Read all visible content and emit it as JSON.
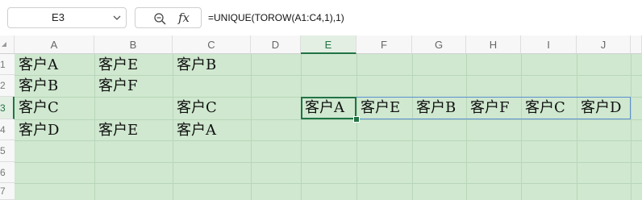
{
  "formula_bar": {
    "name_box": "E3",
    "fx_label": "fx",
    "formula": "=UNIQUE(TOROW(A1:C4,1),1)"
  },
  "columns": [
    "A",
    "B",
    "C",
    "D",
    "E",
    "F",
    "G",
    "H",
    "I",
    "J"
  ],
  "rows": [
    "1",
    "2",
    "3",
    "4",
    "5",
    "6",
    "7"
  ],
  "cells": {
    "A1": "客户A",
    "B1": "客户E",
    "C1": "客户B",
    "A2": "客户B",
    "B2": "客户F",
    "A3": "客户C",
    "C3": "客户C",
    "A4": "客户D",
    "B4": "客户E",
    "C4": "客户A",
    "E3": "客户A",
    "F3": "客户E",
    "G3": "客户B",
    "H3": "客户F",
    "I3": "客户C",
    "J3": "客户D"
  },
  "selected_cell": "E3",
  "colors": {
    "grid_fill": "#cfe8cf",
    "active_border": "#217346",
    "spill_border": "#5b8fd1"
  }
}
